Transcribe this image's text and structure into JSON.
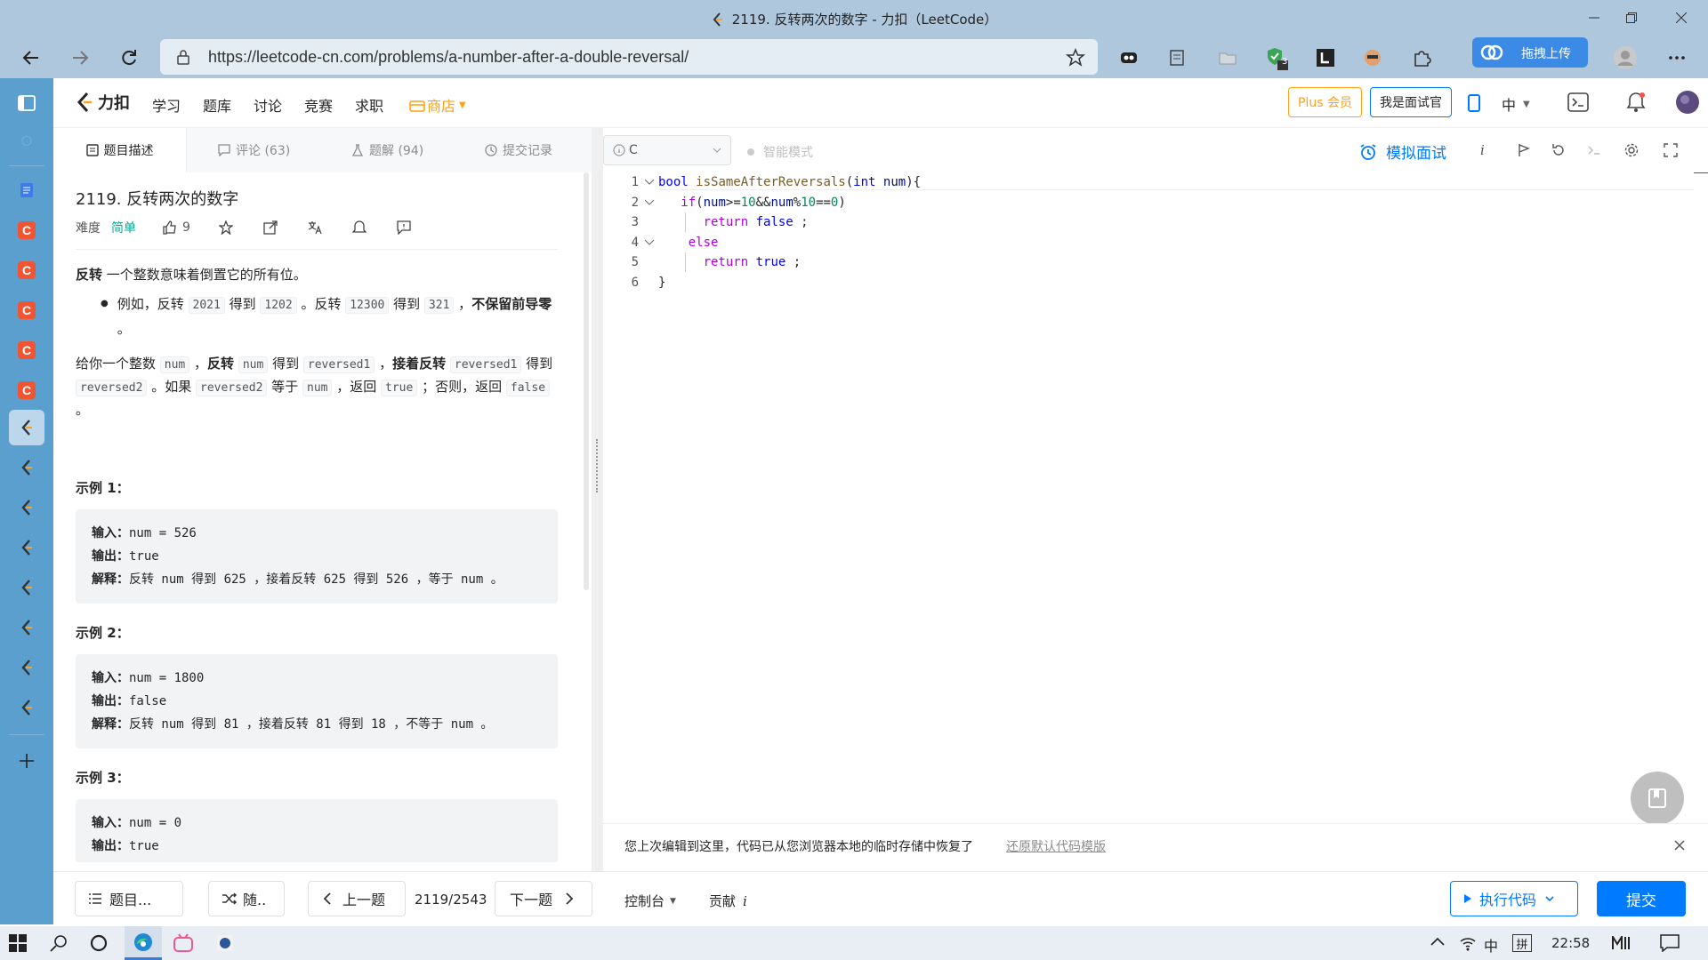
{
  "window": {
    "title": "2119. 反转两次的数字 - 力扣（LeetCode）"
  },
  "browser": {
    "url": "https://leetcode-cn.com/problems/a-number-after-a-double-reversal/",
    "upload_label": "拖拽上传",
    "ext_badge": "3"
  },
  "header": {
    "brand": "力扣",
    "nav": [
      "学习",
      "题库",
      "讨论",
      "竞赛",
      "求职"
    ],
    "store": "商店",
    "plus": "Plus 会员",
    "interviewer": "我是面试官",
    "lang": "中"
  },
  "tabs": [
    {
      "label": "题目描述"
    },
    {
      "label": "评论 (63)"
    },
    {
      "label": "题解 (94)"
    },
    {
      "label": "提交记录"
    }
  ],
  "toolbar": {
    "language": "C",
    "smart_mode": "智能模式",
    "mock_interview": "模拟面试"
  },
  "problem": {
    "title": "2119. 反转两次的数字",
    "difficulty_label": "难度",
    "difficulty": "简单",
    "likes": "9",
    "intro_bold": "反转",
    "intro_rest": " 一个整数意味着倒置它的所有位。",
    "bullet": {
      "t1": "例如，反转 ",
      "c1": "2021",
      "t2": " 得到 ",
      "c2": "1202",
      "t3": " 。反转 ",
      "c3": "12300",
      "t4": " 得到 ",
      "c4": "321",
      "t5": " ，",
      "b1": "不保留前导零",
      "t6": " 。"
    },
    "para": {
      "t1": "给你一个整数 ",
      "c1": "num",
      "t2": " ，",
      "b1": "反转",
      "t3": " ",
      "c2": "num",
      "t4": " 得到 ",
      "c3": "reversed1",
      "t5": " ，",
      "b2": "接着反转",
      "t6": " ",
      "c4": "reversed1",
      "t7": " 得到 ",
      "c5": "reversed2",
      "t8": " 。如果 ",
      "c6": "reversed2",
      "t9": " 等于 ",
      "c7": "num",
      "t10": " ，返回 ",
      "c8": "true",
      "t11": " ；否则，返回 ",
      "c9": "false",
      "t12": " 。"
    },
    "examples": [
      {
        "heading": "示例 1：",
        "in_label": "输入：",
        "input": "num = 526",
        "out_label": "输出：",
        "output": "true",
        "exp_label": "解释：",
        "explain": "反转 num 得到 625 ，接着反转 625 得到 526 ，等于 num 。"
      },
      {
        "heading": "示例 2：",
        "in_label": "输入：",
        "input": "num = 1800",
        "out_label": "输出：",
        "output": "false",
        "exp_label": "解释：",
        "explain": "反转 num 得到 81 ，接着反转 81 得到 18 ，不等于 num 。"
      },
      {
        "heading": "示例 3：",
        "in_label": "输入：",
        "input": "num = 0",
        "out_label": "输出：",
        "output": "true"
      }
    ]
  },
  "code": {
    "line_numbers": [
      "1",
      "2",
      "3",
      "4",
      "5",
      "6"
    ]
  },
  "restore": {
    "message": "您上次编辑到这里，代码已从您浏览器本地的临时存储中恢复了",
    "link": "还原默认代码模版"
  },
  "bottom": {
    "list": "题目...",
    "random": "随..",
    "prev": "上一题",
    "counter": "2119/2543",
    "next": "下一题",
    "console": "控制台",
    "contrib": "贡献",
    "run": "执行代码",
    "submit": "提交"
  },
  "taskbar": {
    "ime": "中",
    "ime2": "拼",
    "time": "22:58"
  },
  "colors": {
    "accent": "#007aff",
    "easy": "#00af9b",
    "orange": "#ffa116",
    "titlebar": "#aec7dc",
    "sidebar": "#5b9fcf"
  }
}
